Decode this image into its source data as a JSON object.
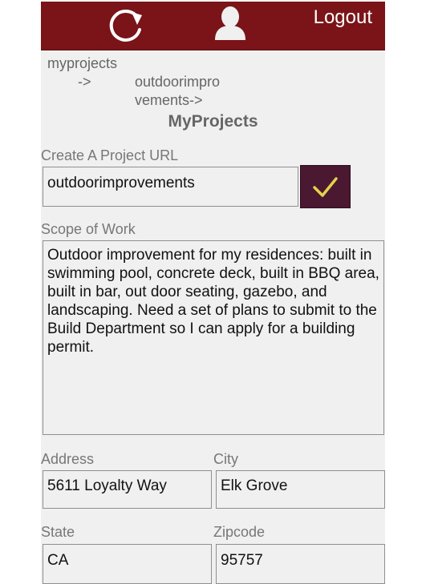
{
  "header": {
    "logout_label": "Logout",
    "refresh_icon": "refresh-icon",
    "profile_icon": "user-profile-icon",
    "bar_color": "#7a1418"
  },
  "breadcrumb": {
    "root": "myprojects",
    "separator": "->",
    "current": "outdoorimprovements->"
  },
  "page": {
    "title": "MyProjects"
  },
  "form": {
    "url_label": "Create A Project URL",
    "url_value": "outdoorimprovements",
    "confirm_icon": "checkmark-icon",
    "confirm_color": "#4a1830",
    "scope_label": "Scope of Work",
    "scope_value": "Outdoor improvement for my residences: built in swimming pool, concrete deck, built in BBQ area, built in bar, out door seating, gazebo, and landscaping. Need a set of plans to submit to the Build Department so I can apply for a building permit.",
    "address_label": "Address",
    "address_value": "5611 Loyalty Way",
    "city_label": "City",
    "city_value": "Elk Grove",
    "state_label": "State",
    "state_value": "CA",
    "zip_label": "Zipcode",
    "zip_value": "95757"
  }
}
